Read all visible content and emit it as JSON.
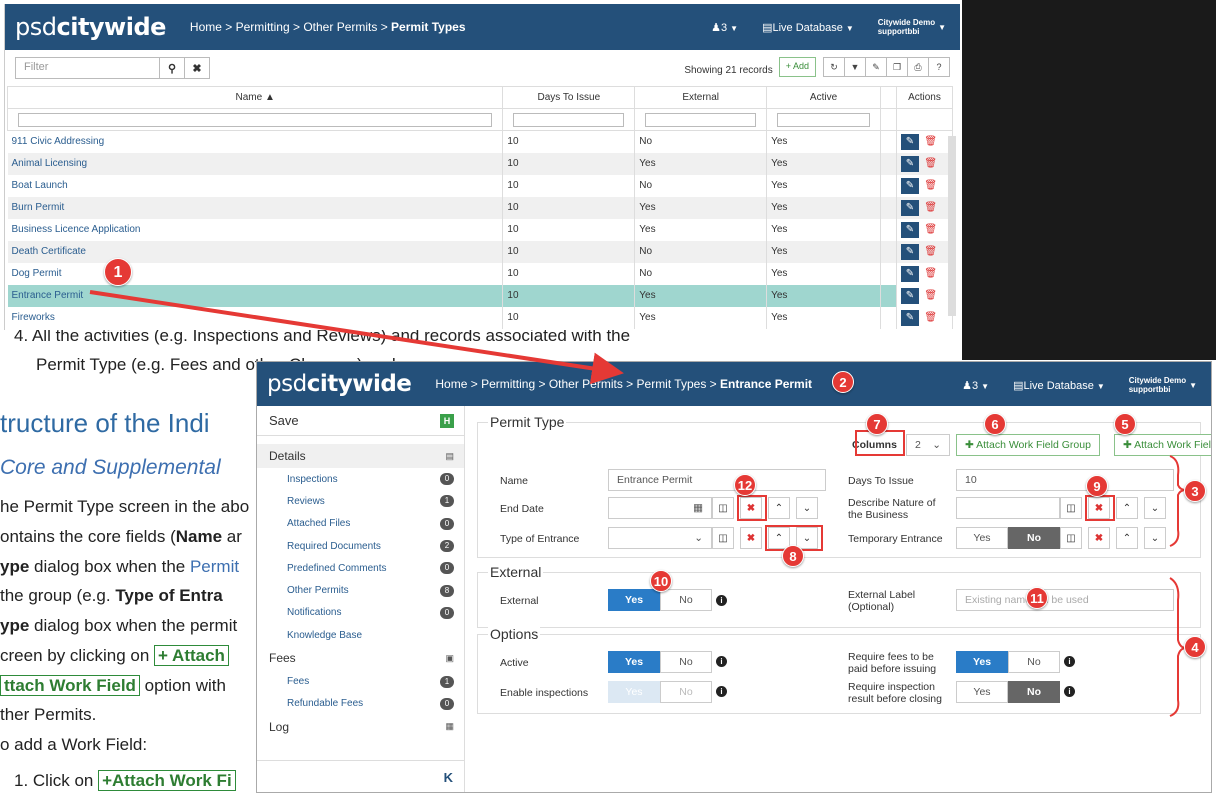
{
  "colors": {
    "navbar": "#24507a",
    "accent": "#2a7cc7",
    "selected_row": "#9fd6cf",
    "annotation": "#e53935",
    "green": "#3a8e3a"
  },
  "doc": {
    "line1": "4.  All the activities (e.g. Inspections and Reviews) and records associated with the",
    "line2": "Permit Type (e.g. Fees and other Changes) and",
    "heading": "tructure of the Indi",
    "subheading": "Core and Supplemental",
    "p1": "he Permit Type screen in the abo",
    "p2a": "ontains the core fields (",
    "p2b": "Name",
    "p2c": " ar",
    "p3a": "ype",
    "p3b": " dialog box when the ",
    "p3c": "Permit",
    "p4a": " the group (e.g. ",
    "p4b": "Type of Entra",
    "p5a": "ype",
    "p5b": " dialog box when the permit",
    "p6a": "creen by clicking on ",
    "p6b": "+ Attach",
    "p7a": "ttach Work Field",
    "p7b": " option with",
    "p8": "ther Permits.",
    "p9": "o add a Work Field:",
    "p10a": "1.  Click on ",
    "p10b": "+Attach Work Fi"
  },
  "shot1": {
    "logo_psd": "psd",
    "logo_city": "citywide",
    "breadcrumb": [
      "Home",
      "Permitting",
      "Other Permits",
      "Permit Types"
    ],
    "users_count": "3",
    "database": "Live Database",
    "user_line1": "Citywide Demo",
    "user_line2": "supportbbi",
    "filter_placeholder": "Filter",
    "showing": "Showing 21 records",
    "add_label": "Add",
    "columns": {
      "name": "Name",
      "days": "Days To Issue",
      "external": "External",
      "active": "Active",
      "actions": "Actions"
    },
    "rows": [
      {
        "name": "911 Civic Addressing",
        "days": "10",
        "external": "No",
        "active": "Yes"
      },
      {
        "name": "Animal Licensing",
        "days": "10",
        "external": "Yes",
        "active": "Yes"
      },
      {
        "name": "Boat Launch",
        "days": "10",
        "external": "No",
        "active": "Yes"
      },
      {
        "name": "Burn Permit",
        "days": "10",
        "external": "Yes",
        "active": "Yes"
      },
      {
        "name": "Business Licence Application",
        "days": "10",
        "external": "Yes",
        "active": "Yes"
      },
      {
        "name": "Death Certificate",
        "days": "10",
        "external": "No",
        "active": "Yes"
      },
      {
        "name": "Dog Permit",
        "days": "10",
        "external": "No",
        "active": "Yes"
      },
      {
        "name": "Entrance Permit",
        "days": "10",
        "external": "Yes",
        "active": "Yes"
      },
      {
        "name": "Fireworks",
        "days": "10",
        "external": "Yes",
        "active": "Yes"
      }
    ]
  },
  "shot2": {
    "breadcrumb": [
      "Home",
      "Permitting",
      "Other Permits",
      "Permit Types",
      "Entrance Permit"
    ],
    "sidebar": {
      "save": "Save",
      "details": "Details",
      "items": [
        {
          "label": "Inspections",
          "count": "0"
        },
        {
          "label": "Reviews",
          "count": "1"
        },
        {
          "label": "Attached Files",
          "count": "0"
        },
        {
          "label": "Required Documents",
          "count": "2"
        },
        {
          "label": "Predefined Comments",
          "count": "0"
        },
        {
          "label": "Other Permits",
          "count": "8"
        },
        {
          "label": "Notifications",
          "count": "0"
        },
        {
          "label": "Knowledge Base",
          "count": ""
        }
      ],
      "fees": "Fees",
      "fee_items": [
        {
          "label": "Fees",
          "count": "1"
        },
        {
          "label": "Refundable Fees",
          "count": "0"
        }
      ],
      "log": "Log",
      "collapse": "K"
    },
    "permit_type": {
      "title": "Permit Type",
      "columns_label": "Columns",
      "columns_value": "2",
      "attach_group": "Attach Work Field Group",
      "attach_field": "Attach Work Field",
      "name_label": "Name",
      "name_value": "Entrance Permit",
      "end_date_label": "End Date",
      "type_label": "Type of Entrance",
      "days_label": "Days To Issue",
      "days_value": "10",
      "describe_label_1": "Describe Nature of",
      "describe_label_2": "the Business",
      "temp_label": "Temporary Entrance"
    },
    "external": {
      "title": "External",
      "external_label": "External",
      "ext_label_1": "External Label",
      "ext_label_2": "(Optional)",
      "ext_placeholder": "Existing name will be used"
    },
    "options": {
      "title": "Options",
      "active_label": "Active",
      "inspections_label": "Enable inspections",
      "fees_label_1": "Require fees to be",
      "fees_label_2": "paid before issuing",
      "result_label_1": "Require inspection",
      "result_label_2": "result before closing"
    },
    "yes": "Yes",
    "no": "No"
  },
  "annotations": [
    "1",
    "2",
    "3",
    "4",
    "5",
    "6",
    "7",
    "8",
    "9",
    "10",
    "11",
    "12"
  ]
}
